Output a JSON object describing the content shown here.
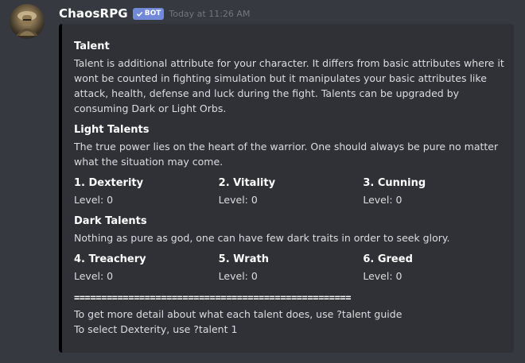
{
  "message": {
    "username": "ChaosRPG",
    "bot_tag": "BOT",
    "timestamp": "Today at 11:26 AM",
    "avatar_icon": "knight-avatar"
  },
  "embed": {
    "accent_color": "#000000",
    "fields": [
      {
        "name": "Talent",
        "value": "Talent is additional attribute for your character. It differs from basic attributes where it wont be counted in fighting simulation but it manipulates your basic attributes like attack, health, defense and luck during the fight. Talents can be upgraded by consuming Dark or Light Orbs."
      },
      {
        "name": "Light Talents",
        "value": "The true power lies on the heart of the warrior. One should always be pure no matter what the situation may come."
      }
    ],
    "light_talents": [
      {
        "name": "1. Dexterity",
        "value": "Level: 0"
      },
      {
        "name": "2. Vitality",
        "value": "Level: 0"
      },
      {
        "name": "3. Cunning",
        "value": "Level: 0"
      }
    ],
    "dark_header": {
      "name": "Dark Talents",
      "value": "Nothing as pure as god, one can have few dark traits in order to seek glory."
    },
    "dark_talents": [
      {
        "name": "4. Treachery",
        "value": "Level: 0"
      },
      {
        "name": "5. Wrath",
        "value": "Level: 0"
      },
      {
        "name": "6. Greed",
        "value": "Level: 0"
      }
    ],
    "separator": "===================================================",
    "footer_lines": [
      "To get more detail about what each talent does, use ?talent guide",
      "To select Dexterity, use ?talent 1"
    ]
  }
}
